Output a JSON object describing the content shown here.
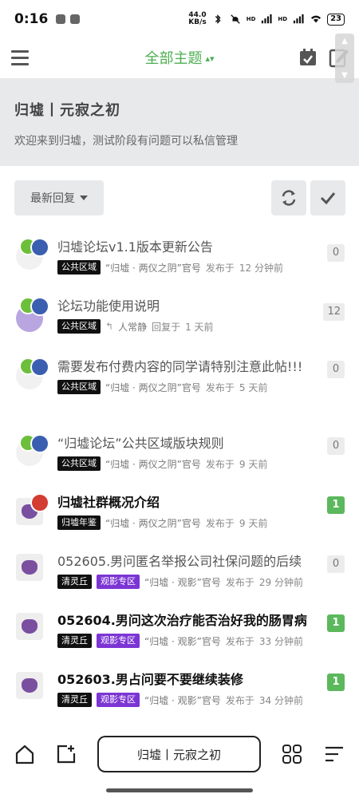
{
  "status_bar": {
    "time": "0:16",
    "speed_value": "44.0",
    "speed_unit": "KB/s",
    "signal1": "HD",
    "signal2": "HD",
    "battery": "23"
  },
  "navbar": {
    "title": "全部主题"
  },
  "hero": {
    "title": "归墟丨元寂之初",
    "description": "欢迎来到归墟，测试阶段有问题可以私信管理"
  },
  "controls": {
    "sort_label": "最新回复"
  },
  "topics": [
    {
      "title": " 归墟论坛v1.1版本更新公告",
      "tags": [
        "公共区域"
      ],
      "author": "“归墟 · 两仪之阴”官号",
      "action": "发布于",
      "time": "12 分钟前",
      "count": "0"
    },
    {
      "title": "论坛功能使用说明",
      "tags": [
        "公共区域"
      ],
      "author": "人常静",
      "action": "回复于",
      "time": "1 天前",
      "count": "12"
    },
    {
      "title": "需要发布付费内容的同学请特别注意此帖!!!",
      "tags": [
        "公共区域"
      ],
      "author": "“归墟 · 两仪之阴”官号",
      "action": "发布于",
      "time": "5 天前",
      "count": "0"
    },
    {
      "title": "“归墟论坛”公共区域版块规则",
      "tags": [
        "公共区域"
      ],
      "author": "“归墟 · 两仪之阴”官号",
      "action": "发布于",
      "time": "9 天前",
      "count": "0"
    },
    {
      "title": "归墟社群概况介绍",
      "tags": [
        "归墟年鉴"
      ],
      "author": "“归墟 · 两仪之阴”官号",
      "action": "发布于",
      "time": "9 天前",
      "count": "1"
    },
    {
      "title": "052605.男问匿名举报公司社保问题的后续",
      "tags": [
        "清灵丘",
        "观影专区"
      ],
      "author": "“归墟 · 观影”官号",
      "action": "发布于",
      "time": "29 分钟前",
      "count": "0"
    },
    {
      "title": "052604.男问这次治疗能否治好我的肠胃病",
      "tags": [
        "清灵丘",
        "观影专区"
      ],
      "author": "“归墟 · 观影”官号",
      "action": "发布于",
      "time": "33 分钟前",
      "count": "1"
    },
    {
      "title": "052603.男占问要不要继续装修",
      "tags": [
        "清灵丘",
        "观影专区"
      ],
      "author": "“归墟 · 观影”官号",
      "action": "发布于",
      "time": "34 分钟前",
      "count": "1"
    }
  ],
  "bottom_bar": {
    "center_label": "归墟丨元寂之初"
  },
  "colors": {
    "accent_green": "#4caf50",
    "count_green": "#5cb85c",
    "tag_black": "#111111",
    "tag_purple": "#7c35d4",
    "hero_bg": "#e8e9eb"
  },
  "icons": [
    "hamburger-icon",
    "calendar-check-icon",
    "edit-icon",
    "refresh-icon",
    "check-icon",
    "home-badge-icon",
    "layers-badge-icon",
    "pin-badge-icon",
    "reply-icon",
    "home-icon",
    "new-post-icon",
    "grid-icon",
    "menu-lines-icon"
  ]
}
